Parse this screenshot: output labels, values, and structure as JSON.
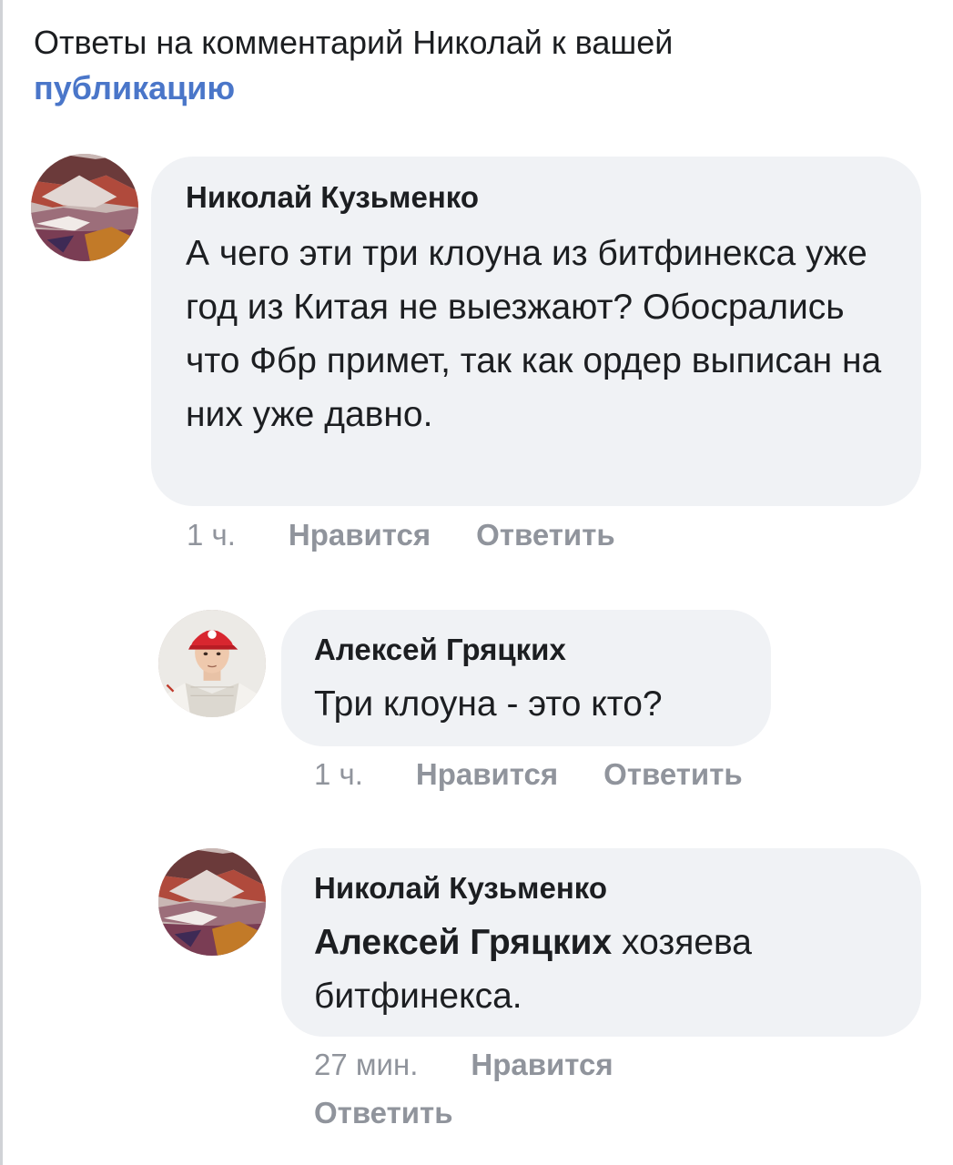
{
  "header": {
    "prefix": "Ответы на комментарий Николай к вашей",
    "link": "публикацию"
  },
  "comments": [
    {
      "author": "Николай Кузьменко",
      "text": "А чего эти три клоуна из битфинекса уже год из Китая не выезжают? Обосрались что Фбр примет, так как ордер выписан на них уже давно.",
      "time": "1 ч.",
      "like": "Нравится",
      "reply": "Ответить"
    },
    {
      "author": "Алексей Гряцких",
      "text": "Три клоуна - это кто?",
      "time": "1 ч.",
      "like": "Нравится",
      "reply": "Ответить"
    },
    {
      "author": "Николай Кузьменко",
      "mention": "Алексей Гряцких",
      "text": " хозяева битфинекса.",
      "time": "27 мин.",
      "like": "Нравится",
      "reply": "Ответить"
    }
  ],
  "colors": {
    "link": "#4a76c9",
    "bubble": "#f0f2f5",
    "meta": "#90949c"
  },
  "icons": {
    "avatar_nikolai": "landscape-avatar",
    "avatar_aleksei": "person-photo-avatar"
  }
}
